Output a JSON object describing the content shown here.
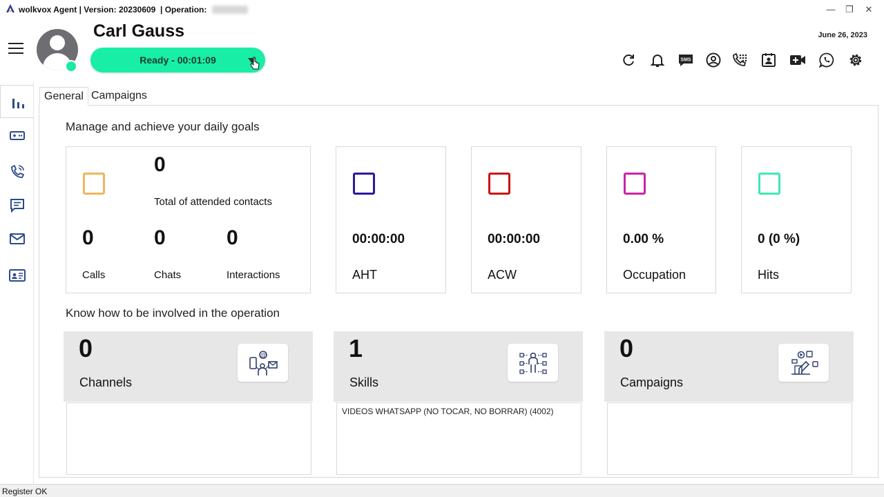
{
  "window": {
    "title": "wolkvox Agent | Version: 20230609  | Operation:",
    "controls": [
      "—",
      "❐",
      "✕"
    ]
  },
  "agent": {
    "name": "Carl Gauss",
    "state_label": "Ready  -  00:01:09",
    "status_color": "#1de9a6"
  },
  "header": {
    "date": "June 26, 2023",
    "toolbar_icons": [
      "refresh-icon",
      "bell-icon",
      "sms-icon",
      "user-circle-icon",
      "dialpad-icon",
      "contact-card-icon",
      "video-add-icon",
      "whatsapp-icon",
      "gear-icon"
    ],
    "sms_text": "SMS"
  },
  "sidebar": {
    "items": [
      "stats-icon",
      "gamepad-icon",
      "phone-icon",
      "chat-icon",
      "mail-icon",
      "contact-list-icon"
    ]
  },
  "tabs": [
    "General",
    "Campaigns"
  ],
  "goals": {
    "title": "Manage and achieve your daily goals",
    "total": {
      "value": "0",
      "label": "Total of attended contacts"
    },
    "calls": {
      "value": "0",
      "label": "Calls"
    },
    "chats": {
      "value": "0",
      "label": "Chats"
    },
    "interactions": {
      "value": "0",
      "label": "Interactions"
    },
    "aht": {
      "value": "00:00:00",
      "label": "AHT"
    },
    "acw": {
      "value": "00:00:00",
      "label": "ACW"
    },
    "occupation": {
      "value": "0.00 %",
      "label": "Occupation"
    },
    "hits": {
      "value": "0 (0 %)",
      "label": "Hits"
    },
    "colors": {
      "total": "#f0b55a",
      "aht": "#2a1a9e",
      "acw": "#cc1111",
      "occupation": "#cc22aa",
      "hits": "#3ee8b8"
    }
  },
  "involvement": {
    "title": "Know how to be involved in the operation",
    "channels": {
      "count": "0",
      "label": "Channels",
      "items": []
    },
    "skills": {
      "count": "1",
      "label": "Skills",
      "items": [
        "VIDEOS WHATSAPP (NO TOCAR, NO BORRAR) (4002)"
      ]
    },
    "campaigns": {
      "count": "0",
      "label": "Campaigns",
      "items": []
    }
  },
  "statusbar": {
    "text": "Register OK"
  }
}
